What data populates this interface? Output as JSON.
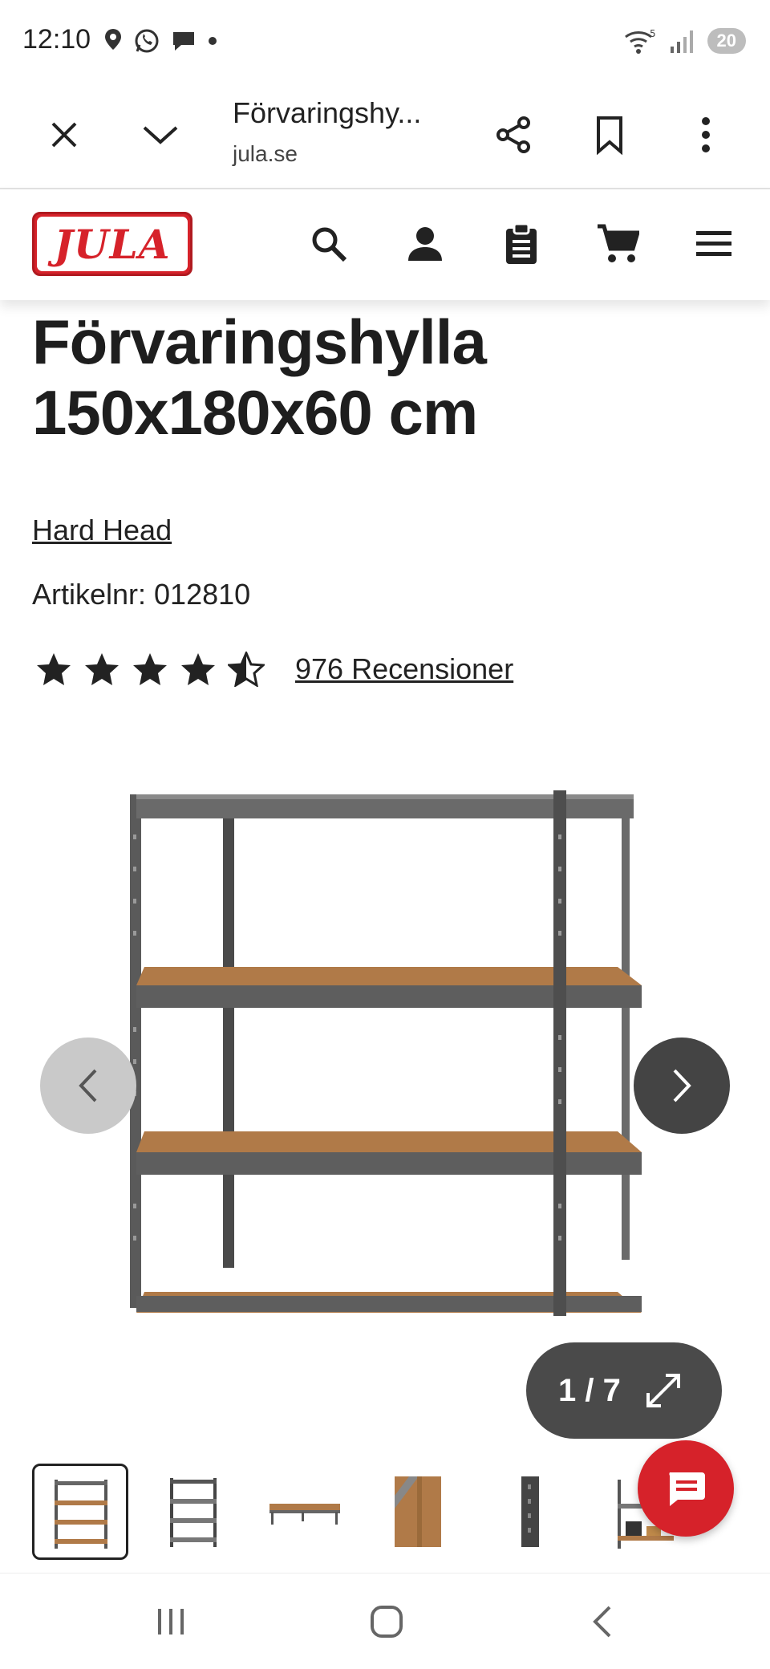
{
  "status_bar": {
    "time": "12:10",
    "battery": "20",
    "signal_label": "5"
  },
  "browser": {
    "page_title": "Förvaringshy...",
    "url": "jula.se"
  },
  "site": {
    "logo_text": "JULA"
  },
  "product": {
    "title_line1": "Förvaringshylla",
    "title_line2": "150x180x60 cm",
    "brand": "Hard Head",
    "article_no": "Artikelnr: 012810",
    "rating": 4.5,
    "rating_max": 5,
    "reviews": "976 Recensioner"
  },
  "gallery": {
    "counter": "1 / 7",
    "current": 1,
    "total": 7
  },
  "colors": {
    "brand_red": "#d6222a",
    "text": "#222222",
    "shelf_metal": "#5a5a5a",
    "shelf_board": "#b07a48"
  }
}
